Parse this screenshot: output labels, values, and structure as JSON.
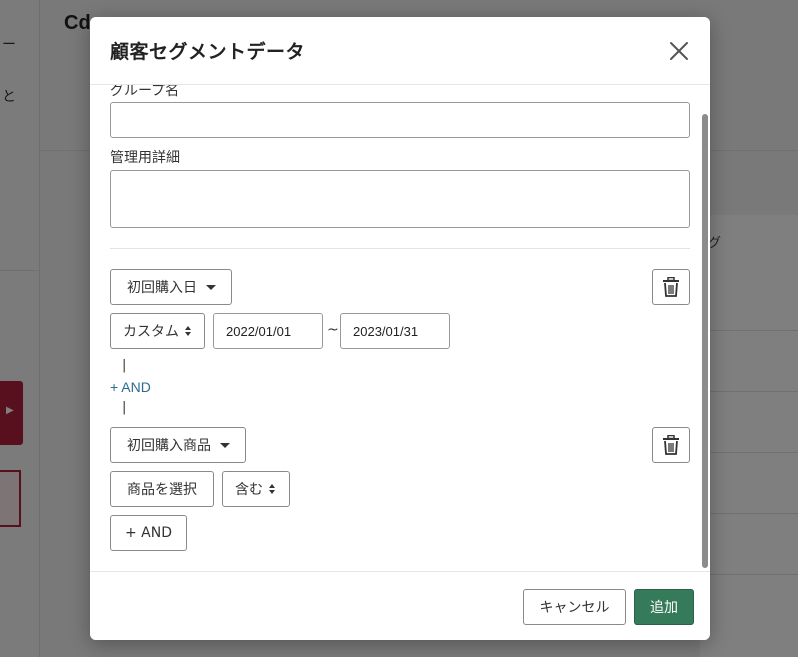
{
  "background": {
    "title": "Cd",
    "side_text_1": "ー",
    "side_text_2": "と",
    "panel_text": "グ",
    "accent": "#b3203c"
  },
  "modal": {
    "title": "顧客セグメントデータ",
    "close_icon": "close-icon"
  },
  "form": {
    "group_name_label": "グループ名",
    "group_name_value": "",
    "admin_detail_label": "管理用詳細",
    "admin_detail_value": ""
  },
  "condition_1": {
    "field_label": "初回購入日",
    "range_select": "カスタム",
    "start_date": "2022/01/01",
    "separator": "~",
    "end_date": "2023/01/31"
  },
  "connector": {
    "pipe": "|",
    "and_link": "+ AND"
  },
  "condition_2": {
    "field_label": "初回購入商品",
    "select_product": "商品を選択",
    "match_select": "含む"
  },
  "add_and_button": "+ AND",
  "footer": {
    "cancel_label": "キャンセル",
    "add_label": "追加",
    "add_color": "#357b5a"
  }
}
